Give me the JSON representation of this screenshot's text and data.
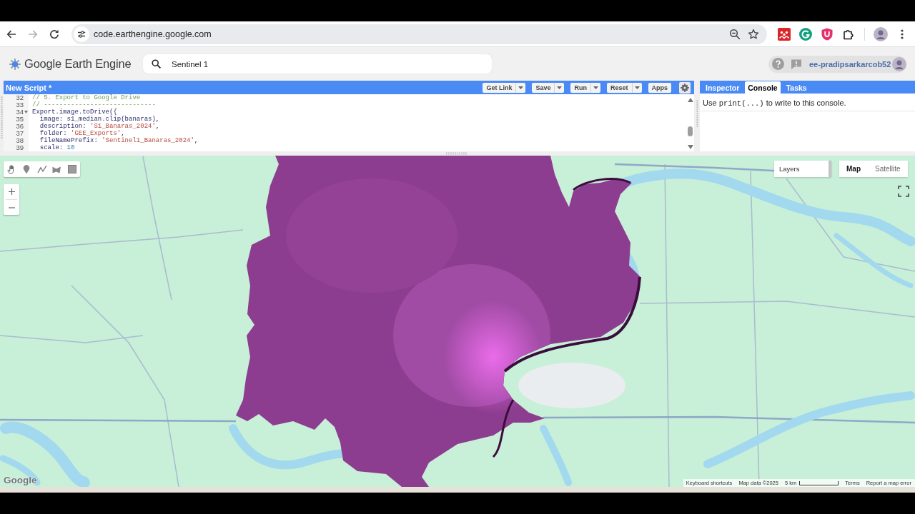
{
  "browser": {
    "url": "code.earthengine.google.com",
    "forward_disabled": true
  },
  "header": {
    "title": "Google Earth Engine",
    "search": {
      "value": "Sentinel 1"
    },
    "account": "ee-pradipsarkarcob52"
  },
  "script_bar": {
    "title": "New Script *",
    "buttons": [
      {
        "label": "Get Link",
        "dropdown": true
      },
      {
        "label": "Save",
        "dropdown": true
      },
      {
        "label": "Run",
        "dropdown": true
      },
      {
        "label": "Reset",
        "dropdown": true
      },
      {
        "label": "Apps",
        "dropdown": false
      }
    ]
  },
  "code": {
    "lines": [
      {
        "number": "32",
        "fold": false,
        "tokens": [
          {
            "kind": "comment",
            "text": "// 5. Export to Google Drive"
          }
        ]
      },
      {
        "number": "33",
        "fold": false,
        "tokens": [
          {
            "kind": "comment",
            "text": "// -----------------------------"
          }
        ]
      },
      {
        "number": "34",
        "fold": true,
        "tokens": [
          {
            "kind": "plain",
            "text": "Export.image.toDrive({"
          }
        ]
      },
      {
        "number": "35",
        "fold": false,
        "tokens": [
          {
            "kind": "plain",
            "text": "  image: s1_median.clip(banaras),"
          }
        ]
      },
      {
        "number": "36",
        "fold": false,
        "tokens": [
          {
            "kind": "plain",
            "text": "  description: "
          },
          {
            "kind": "string",
            "text": "'S1_Banaras_2024'"
          },
          {
            "kind": "plain",
            "text": ","
          }
        ]
      },
      {
        "number": "37",
        "fold": false,
        "tokens": [
          {
            "kind": "plain",
            "text": "  folder: "
          },
          {
            "kind": "string",
            "text": "'GEE_Exports'"
          },
          {
            "kind": "plain",
            "text": ","
          }
        ]
      },
      {
        "number": "38",
        "fold": false,
        "tokens": [
          {
            "kind": "plain",
            "text": "  fileNamePrefix: "
          },
          {
            "kind": "string",
            "text": "'Sentinel1_Banaras_2024'"
          },
          {
            "kind": "plain",
            "text": ","
          }
        ]
      },
      {
        "number": "39",
        "fold": false,
        "tokens": [
          {
            "kind": "plain",
            "text": "  scale: "
          },
          {
            "kind": "number",
            "text": "10"
          }
        ]
      }
    ]
  },
  "side_panel": {
    "tabs": [
      {
        "label": "Inspector",
        "selected": false
      },
      {
        "label": "Console",
        "selected": true
      },
      {
        "label": "Tasks",
        "selected": false
      }
    ],
    "console_message": [
      {
        "kind": "text",
        "text": "Use "
      },
      {
        "kind": "code",
        "text": "print(...)"
      },
      {
        "kind": "text",
        "text": " to write to this console."
      }
    ]
  },
  "map": {
    "layers_label": "Layers",
    "map_types": [
      {
        "label": "Map",
        "selected": true
      },
      {
        "label": "Satellite",
        "selected": false
      }
    ],
    "logo": "Google",
    "footer": [
      {
        "kind": "link",
        "text": "Keyboard shortcuts"
      },
      {
        "kind": "text",
        "text": "Map data ©2025"
      },
      {
        "kind": "scale",
        "text": "5 km"
      },
      {
        "kind": "link",
        "text": "Terms"
      },
      {
        "kind": "link",
        "text": "Report a map error"
      }
    ]
  }
}
